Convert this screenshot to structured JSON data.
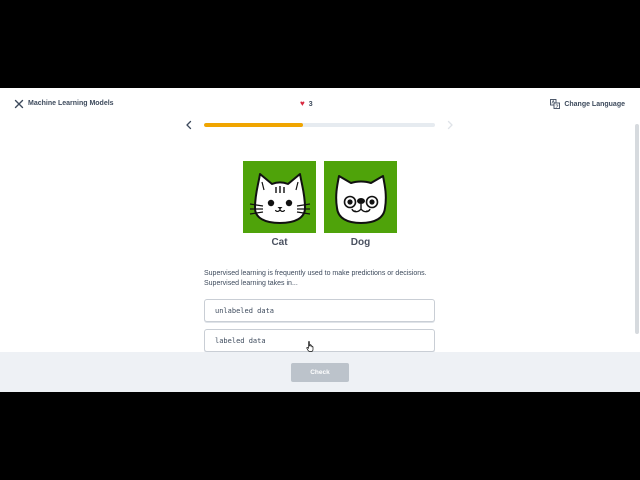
{
  "header": {
    "course_title": "Machine Learning Models",
    "lives": "3",
    "change_language": "Change Language"
  },
  "progress": {
    "value": 0.43
  },
  "pictures": [
    {
      "label": "Cat",
      "icon": "cat-face-icon"
    },
    {
      "label": "Dog",
      "icon": "dog-face-icon"
    }
  ],
  "question": {
    "text": "Supervised learning is frequently used to make predictions or decisions. Supervised learning takes in..."
  },
  "options": [
    {
      "label": "unlabeled data"
    },
    {
      "label": "labeled data"
    }
  ],
  "footer": {
    "check_label": "Check"
  },
  "colors": {
    "accent": "#f0a500",
    "picture_bg": "#4fa30a",
    "heart": "#d8283f",
    "check_disabled": "#bcc3cb"
  }
}
